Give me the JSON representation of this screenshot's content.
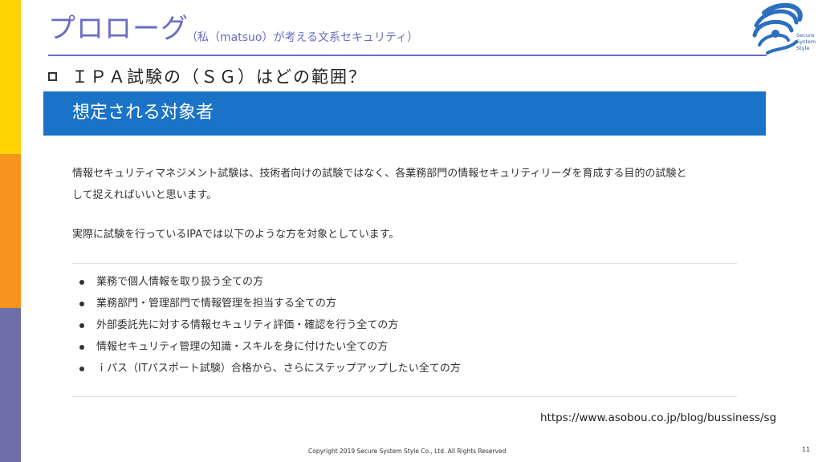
{
  "slide": {
    "title": "プロローグ",
    "subtitle": "（私（matsuo）が考える文系セキュリティ）",
    "bullet": "ＩＰＡ試験の（ＳＧ）はどの範囲？",
    "logo_text": [
      "Secure",
      "System",
      "Style"
    ],
    "source_url": "https://www.asobou.co.jp/blog/bussiness/sg",
    "copyright": "Copyright 2019 Secure System Style Co., Ltd. All Rights Reserved",
    "page_number": "11"
  },
  "panel": {
    "heading": "想定される対象者",
    "para1_line1": "情報セキュリティマネジメント試験は、技術者向けの試験ではなく、各業務部門の情報セキュリティリーダを育成する目的の試験と",
    "para1_line2": "して捉えればいいと思います。",
    "para2": "実際に試験を行っているIPAでは以下のような方を対象としています。",
    "items": [
      "業務で個人情報を取り扱う全ての方",
      "業務部門・管理部門で情報管理を担当する全ての方",
      "外部委託先に対する情報セキュリティ評価・確認を行う全ての方",
      "情報セキュリティ管理の知識・スキルを身に付けたい全ての方",
      "ｉパス（ITパスポート試験）合格から、さらにステップアップしたい全ての方"
    ]
  },
  "colors": {
    "accent": "#6a6cc4",
    "panel_header": "#1a73c6",
    "stripe_yellow": "#ffd400",
    "stripe_orange": "#f7941d",
    "stripe_purple": "#6e6fa8"
  }
}
